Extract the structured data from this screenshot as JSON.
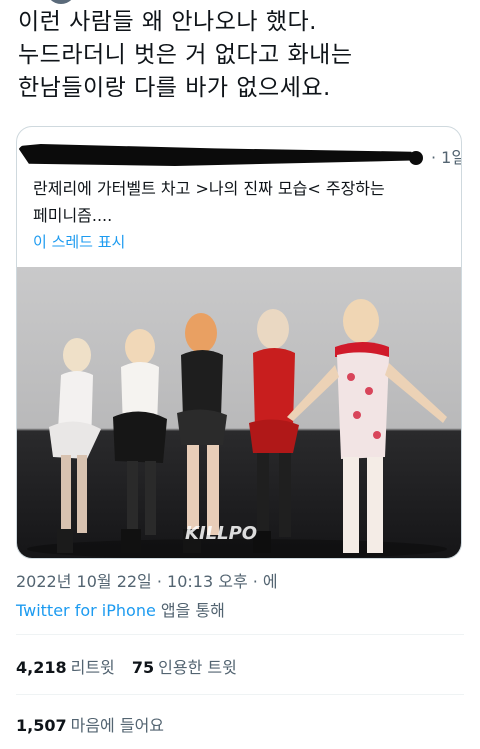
{
  "tweet": {
    "text_lines": [
      "이런 사람들 왜 안나오나 했다.",
      "누드라더니 벗은 거 없다고 화내는",
      "한남들이랑 다를 바가 없으세요."
    ],
    "date": "2022년 10월 22일 · 10:13 오후 · 에",
    "source_app": "Twitter for iPhone",
    "source_suffix": " 앱을 통해"
  },
  "quoted_tweet": {
    "time": "· 1일",
    "text_lines": [
      "란제리에 가터벨트 차고 >나의 진짜 모습< 주장하는",
      "페미니즘...."
    ],
    "thread_link": "이 스레드 표시",
    "media_watermark": "KILLPO"
  },
  "stats": {
    "retweets_count": "4,218",
    "retweets_label": "리트윗",
    "quotes_count": "75",
    "quotes_label": "인용한 트윗",
    "likes_count": "1,507",
    "likes_label": "마음에 들어요"
  },
  "colors": {
    "text": "#0f1419",
    "secondary": "#536471",
    "link": "#1d9bf0",
    "border": "#cfd9de"
  }
}
